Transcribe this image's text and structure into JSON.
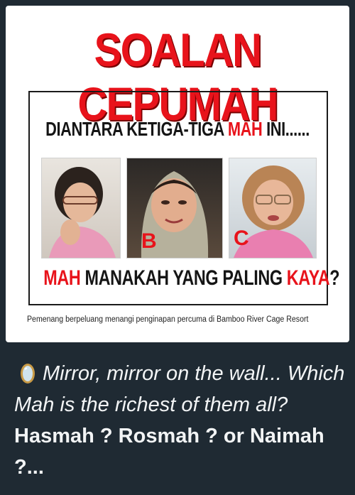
{
  "card": {
    "headline": "SOALAN CEPUMAH",
    "question_pre": "DIANTARA KETIGA-TIGA ",
    "question_mah": "MAH",
    "question_post": " INI......",
    "letter_b": "B",
    "letter_c": "C",
    "answer_pre": "MAH",
    "answer_mid": " MANAKAH YANG PALING ",
    "answer_kaya": "KAYA",
    "answer_end": "?",
    "footnote": "Pemenang berpeluang menangi penginapan percuma di Bamboo River Cage Resort"
  },
  "caption": {
    "icon": "mirror-emoji",
    "text": "Mirror, mirror on the wall... Which Mah is the richest of them all?",
    "bold": "Hasmah ? Rosmah ? or Naimah ?..."
  },
  "colors": {
    "accent": "#e8131b",
    "background": "#1f2a33",
    "text": "#f2f4f5"
  }
}
